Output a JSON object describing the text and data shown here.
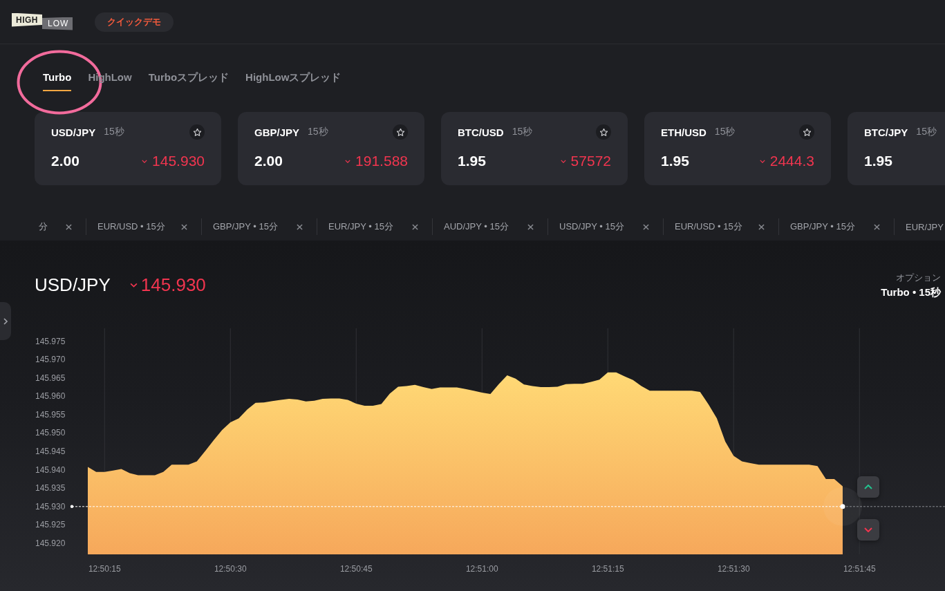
{
  "header": {
    "logo": {
      "upper": "HIGH",
      "lower": "LOW"
    },
    "badge": "クイックデモ"
  },
  "highlight": {
    "kind": "circle"
  },
  "tabs": [
    {
      "label": "Turbo",
      "selected": true
    },
    {
      "label": "HighLow",
      "selected": false
    },
    {
      "label": "Turboスプレッド",
      "selected": false
    },
    {
      "label": "HighLowスプレッド",
      "selected": false
    }
  ],
  "cards": [
    {
      "pair": "USD/JPY",
      "duration": "15秒",
      "favorite": false,
      "payout": "2.00",
      "rising": false,
      "price": "145.930"
    },
    {
      "pair": "GBP/JPY",
      "duration": "15秒",
      "favorite": false,
      "payout": "2.00",
      "rising": false,
      "price": "191.588"
    },
    {
      "pair": "BTC/USD",
      "duration": "15秒",
      "favorite": false,
      "payout": "1.95",
      "rising": false,
      "price": "57572"
    },
    {
      "pair": "ETH/USD",
      "duration": "15秒",
      "favorite": false,
      "payout": "1.95",
      "rising": false,
      "price": "2444.3"
    },
    {
      "pair": "BTC/JPY",
      "duration": "15秒",
      "payout": "1.95"
    }
  ],
  "recent_assets": [
    {
      "label": "分"
    },
    {
      "label": "EUR/USD • 15分"
    },
    {
      "label": "GBP/JPY • 15分"
    },
    {
      "label": "EUR/JPY • 15分"
    },
    {
      "label": "AUD/JPY • 15分"
    },
    {
      "label": "USD/JPY • 15分"
    },
    {
      "label": "EUR/USD • 15分"
    },
    {
      "label": "GBP/JPY • 15分"
    },
    {
      "label": "EUR/JPY"
    }
  ],
  "chart": {
    "pair": "USD/JPY",
    "rising": false,
    "price": "145.930",
    "option_label": "オプション",
    "option_value": "Turbo • 15秒",
    "chart_data": {
      "type": "area",
      "grid": true,
      "categories": [
        null,
        null,
        "12:50:15",
        null,
        null,
        null,
        null,
        null,
        null,
        null,
        null,
        null,
        null,
        null,
        null,
        null,
        null,
        "12:50:30",
        null,
        null,
        null,
        null,
        null,
        null,
        null,
        null,
        null,
        null,
        null,
        null,
        null,
        null,
        "12:50:45",
        null,
        null,
        null,
        null,
        null,
        null,
        null,
        null,
        null,
        null,
        null,
        null,
        null,
        null,
        "12:51:00",
        null,
        null,
        null,
        null,
        null,
        null,
        null,
        null,
        null,
        null,
        null,
        null,
        null,
        null,
        "12:51:15",
        null,
        null,
        null,
        null,
        null,
        null,
        null,
        null,
        null,
        null,
        null,
        null,
        null,
        null,
        "12:51:30",
        null,
        null,
        null,
        null,
        null,
        null,
        null,
        null,
        null,
        null,
        null,
        null,
        null,
        null,
        "12:51:45"
      ],
      "values": [
        145.9408,
        145.9394,
        145.9394,
        145.9398,
        145.9402,
        145.9391,
        145.9385,
        145.9385,
        145.9385,
        145.9394,
        145.9414,
        145.9414,
        145.9414,
        145.9423,
        145.9451,
        145.948,
        145.9508,
        145.9529,
        145.954,
        145.9564,
        145.9582,
        145.9583,
        145.9587,
        145.959,
        145.9593,
        145.9591,
        145.9586,
        145.9588,
        145.9593,
        145.9594,
        145.9594,
        145.959,
        145.958,
        145.9574,
        145.9574,
        145.9579,
        145.9607,
        145.9626,
        145.9628,
        145.9631,
        145.9625,
        145.962,
        145.9624,
        145.9624,
        145.9624,
        145.962,
        145.9615,
        145.961,
        145.9606,
        145.9633,
        145.9657,
        145.9648,
        145.9632,
        145.9628,
        145.9625,
        145.9625,
        145.9626,
        145.9633,
        145.9634,
        145.9634,
        145.9639,
        145.9645,
        145.9665,
        145.9665,
        145.9654,
        145.9644,
        145.9628,
        145.9615,
        145.9615,
        145.9615,
        145.9615,
        145.9615,
        145.9615,
        145.9612,
        145.9578,
        145.954,
        145.9477,
        145.9438,
        145.9423,
        145.9418,
        145.9414,
        145.9414,
        145.9414,
        145.9414,
        145.9414,
        145.9414,
        145.9414,
        145.941,
        145.9375,
        145.9375,
        145.9355,
        null,
        null
      ],
      "ylim": [
        145.917,
        145.9785
      ],
      "yticks": [
        {
          "value": 145.975,
          "label": "145.975"
        },
        {
          "value": 145.97,
          "label": "145.970"
        },
        {
          "value": 145.965,
          "label": "145.965"
        },
        {
          "value": 145.96,
          "label": "145.960"
        },
        {
          "value": 145.955,
          "label": "145.955"
        },
        {
          "value": 145.95,
          "label": "145.950"
        },
        {
          "value": 145.945,
          "label": "145.945"
        },
        {
          "value": 145.94,
          "label": "145.940"
        },
        {
          "value": 145.935,
          "label": "145.935"
        },
        {
          "value": 145.93,
          "label": "145.930"
        },
        {
          "value": 145.925,
          "label": "145.925"
        },
        {
          "value": 145.92,
          "label": "145.920"
        }
      ],
      "ref_lines": [
        {
          "axis": "y",
          "value": 145.93
        }
      ]
    }
  }
}
